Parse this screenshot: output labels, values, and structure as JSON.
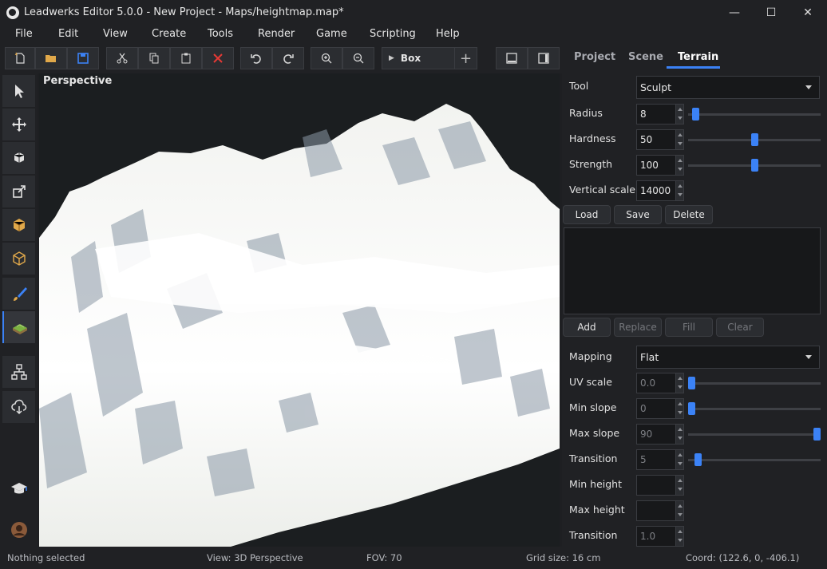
{
  "window": {
    "title": "Leadwerks Editor 5.0.0 - New Project - Maps/heightmap.map*",
    "minimize": "—",
    "maximize": "☐",
    "close": "✕"
  },
  "menu": [
    "File",
    "Edit",
    "View",
    "Create",
    "Tools",
    "Render",
    "Game",
    "Scripting",
    "Help"
  ],
  "toolbar": {
    "object_type": "Box",
    "add_glyph": "+",
    "play_glyph": "▶"
  },
  "viewport": {
    "label": "Perspective"
  },
  "panel": {
    "tabs": [
      "Project",
      "Scene",
      "Terrain"
    ],
    "active_tab": "Terrain",
    "tool_label": "Tool",
    "tool_value": "Sculpt",
    "radius_label": "Radius",
    "radius_value": "8",
    "radius_level": 0.03,
    "hardness_label": "Hardness",
    "hardness_value": "50",
    "hardness_level": 0.5,
    "strength_label": "Strength",
    "strength_value": "100",
    "strength_level": 0.5,
    "vscale_label": "Vertical scale",
    "vscale_value": "14000",
    "load_label": "Load",
    "save_label": "Save",
    "delete_label": "Delete",
    "add_label": "Add",
    "replace_label": "Replace",
    "fill_label": "Fill",
    "clear_label": "Clear",
    "mapping_label": "Mapping",
    "mapping_value": "Flat",
    "uvscale_label": "UV scale",
    "uvscale_value": "0.0",
    "uvscale_level": 0.0,
    "minslope_label": "Min slope",
    "minslope_value": "0",
    "minslope_level": 0.0,
    "maxslope_label": "Max slope",
    "maxslope_value": "90",
    "maxslope_level": 1.0,
    "transition_label": "Transition",
    "transition_value": "5",
    "transition_level": 0.05,
    "minheight_label": "Min height",
    "minheight_value": "",
    "maxheight_label": "Max height",
    "maxheight_value": "",
    "transition2_label": "Transition",
    "transition2_value": "1.0"
  },
  "status": {
    "selection": "Nothing selected",
    "view": "View: 3D Perspective",
    "fov": "FOV: 70",
    "grid": "Grid size: 16 cm",
    "coord": "Coord: (122.6, 0, -406.1)"
  },
  "colors": {
    "accent": "#3b82f6",
    "delete_icon": "#e53935",
    "save_icon": "#3b82f6",
    "open_icon": "#e0a84a",
    "terrain_icon": "#7cb342"
  }
}
